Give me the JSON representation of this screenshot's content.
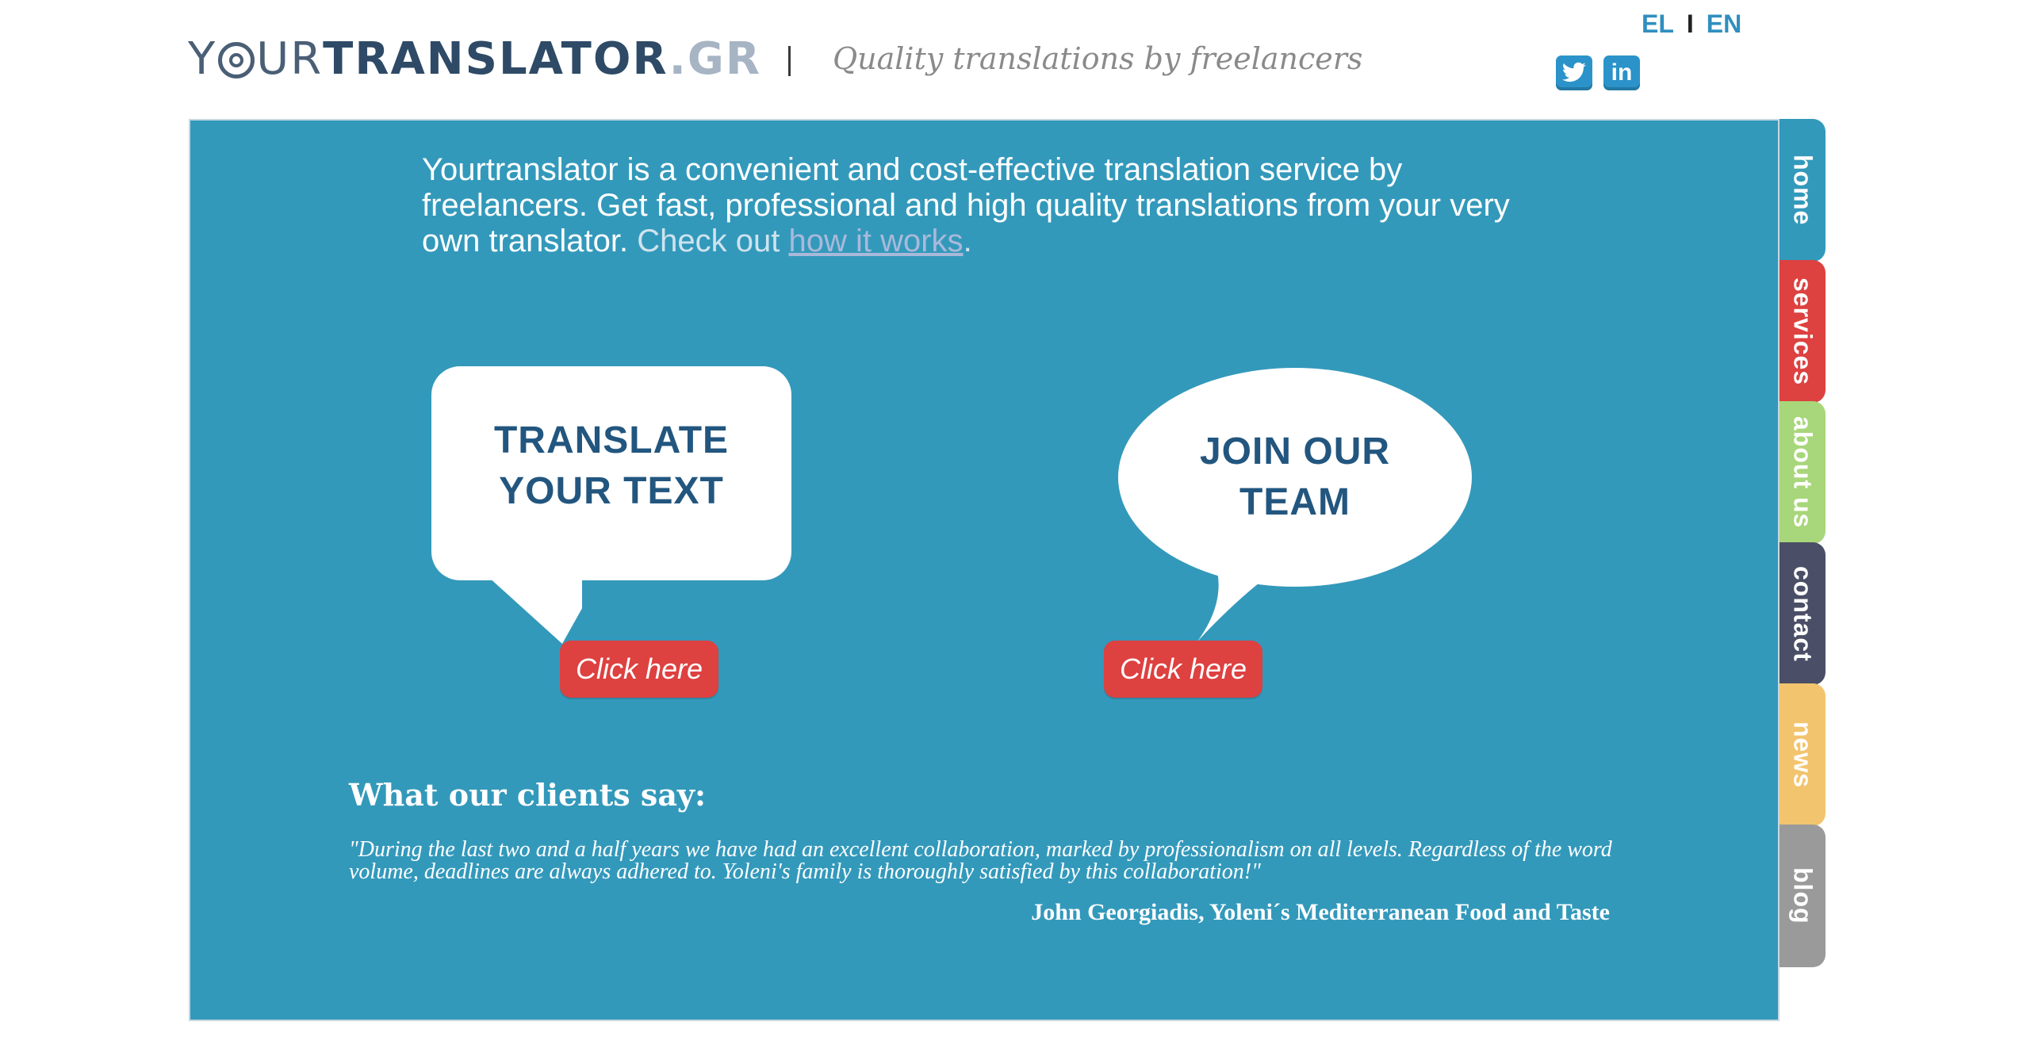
{
  "header": {
    "logo": {
      "your": "Y",
      "your_rest": "UR",
      "translator": "TRANSLATOR",
      "domain": ".GR"
    },
    "tagline": "Quality translations by freelancers",
    "languages": {
      "el": "EL",
      "separator": "I",
      "en": "EN"
    },
    "social": [
      {
        "icon": "twitter-icon",
        "glyph": "t"
      },
      {
        "icon": "linkedin-icon",
        "glyph": "in"
      }
    ]
  },
  "intro": {
    "text": "Yourtranslator is a convenient and cost-effective translation service by freelancers. Get fast, professional and high quality translations from your very own translator.",
    "check_prefix": "Check out",
    "link": "how it works",
    "suffix": "."
  },
  "cta": {
    "translate": {
      "line1": "TRANSLATE",
      "line2": "YOUR TEXT",
      "button": "Click here"
    },
    "join": {
      "line1": "JOIN OUR",
      "line2": "TEAM",
      "button": "Click here"
    }
  },
  "testimonials": {
    "heading": "What our clients say:",
    "quote": "\"During the last two and a half years we have had an excellent collaboration, marked by professionalism on all levels. Regardless of the word volume, deadlines are always adhered to. Yoleni's family is thoroughly satisfied by this collaboration!\"",
    "author": "John Georgiadis, Yoleni´s Mediterranean Food and Taste"
  },
  "tabs": [
    {
      "label": "home",
      "color": "#3399bb"
    },
    {
      "label": "services",
      "color": "#dd4140"
    },
    {
      "label": "about us",
      "color": "#a8d67a"
    },
    {
      "label": "contact",
      "color": "#4a4e66"
    },
    {
      "label": "news",
      "color": "#f3c46e"
    },
    {
      "label": "blog",
      "color": "#9a9a9a"
    }
  ],
  "colors": {
    "panel": "#3399bb",
    "button": "#dd4140",
    "bubble_text": "#22567f",
    "lang": "#2f8fbf"
  }
}
